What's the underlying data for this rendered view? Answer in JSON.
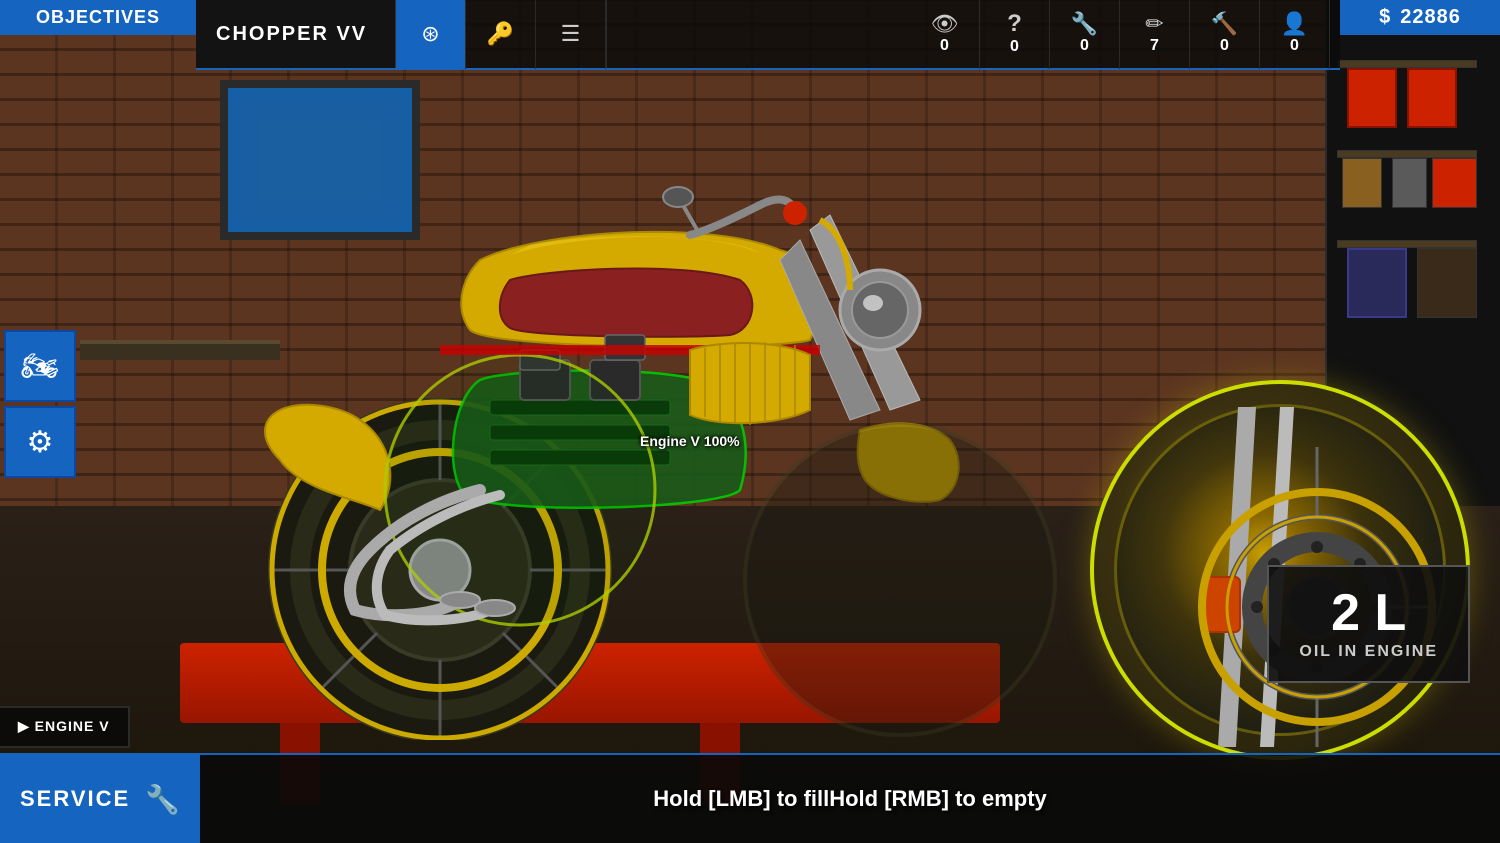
{
  "ui": {
    "objectives_label": "Objectives",
    "vehicle_name": "CHOPPER VV",
    "money_symbol": "$",
    "money_amount": "22886",
    "engine_label": "Engine V 100%",
    "engine_tab_arrow": "▶",
    "engine_tab_label": "ENGINE V",
    "bottom_hint": "Hold [LMB] to fillHold [RMB] to empty",
    "service_label": "SERVICE",
    "oil_amount": "2 L",
    "oil_label": "OIL IN ENGINE"
  },
  "top_icons": [
    {
      "symbol": "👁",
      "count": "0",
      "active": false,
      "name": "view-icon"
    },
    {
      "symbol": "?",
      "count": "0",
      "active": false,
      "name": "help-icon"
    },
    {
      "symbol": "🔧",
      "count": "0",
      "active": false,
      "name": "wrench-icon"
    },
    {
      "symbol": "✏",
      "count": "7",
      "active": false,
      "name": "edit-icon"
    },
    {
      "symbol": "🔨",
      "count": "0",
      "active": false,
      "name": "hammer-icon"
    },
    {
      "symbol": "👤",
      "count": "0",
      "active": false,
      "name": "person-icon"
    }
  ],
  "left_panel_buttons": [
    {
      "symbol": "🏍",
      "name": "motorcycle-view-btn"
    },
    {
      "symbol": "⚙",
      "name": "engine-view-btn"
    }
  ],
  "colors": {
    "blue": "#1565c0",
    "dark_bg": "#0d0d0d",
    "yellow_accent": "#ccdd00",
    "green_highlight": "#00cc00"
  }
}
